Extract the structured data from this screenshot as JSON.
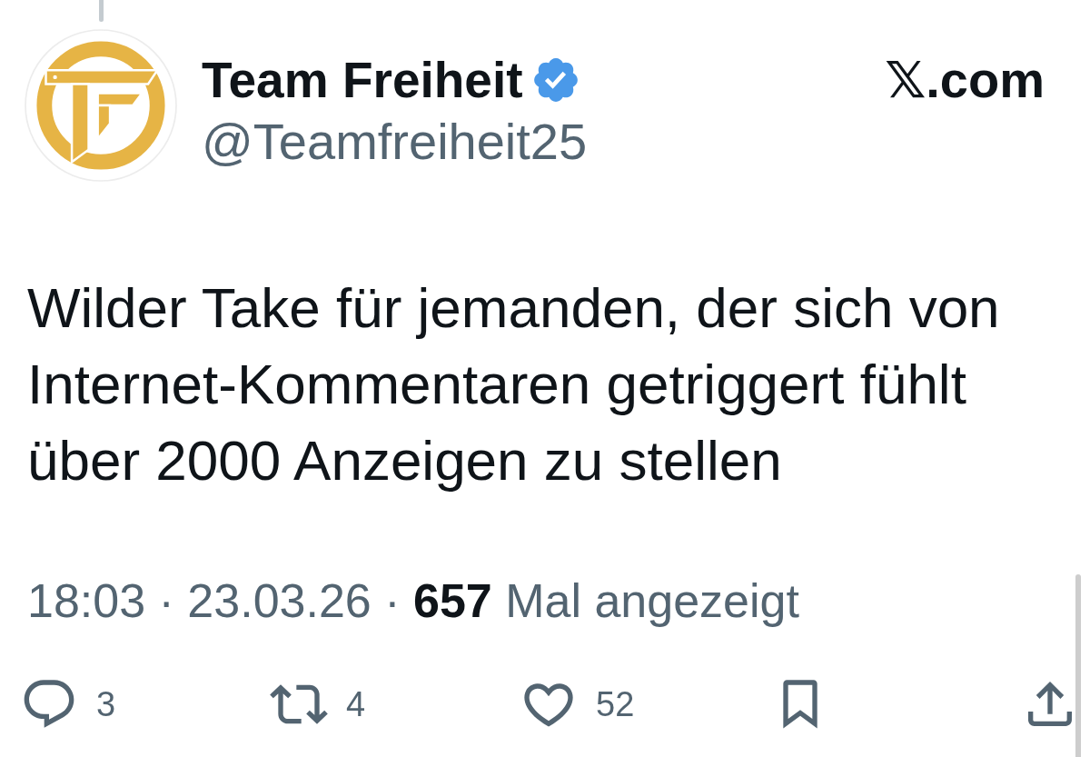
{
  "author": {
    "name": "Team Freiheit",
    "verified": true,
    "handle": "@Teamfreiheit25"
  },
  "site": "𝕏.com",
  "text": "Wilder Take für jemanden, der sich von\nInternet-Kommentaren getriggert fühlt\nüber 2000 Anzeigen zu stellen",
  "meta": "18:03 · 23.03.26 · **657** Mal angezeigt",
  "actions": [
    {
      "kind": "reply",
      "count": "3",
      "active": false
    },
    {
      "kind": "repost",
      "count": "4",
      "active": false
    },
    {
      "kind": "like",
      "count": "52",
      "active": false
    },
    {
      "kind": "bookmark",
      "active": false
    },
    {
      "kind": "share"
    }
  ]
}
